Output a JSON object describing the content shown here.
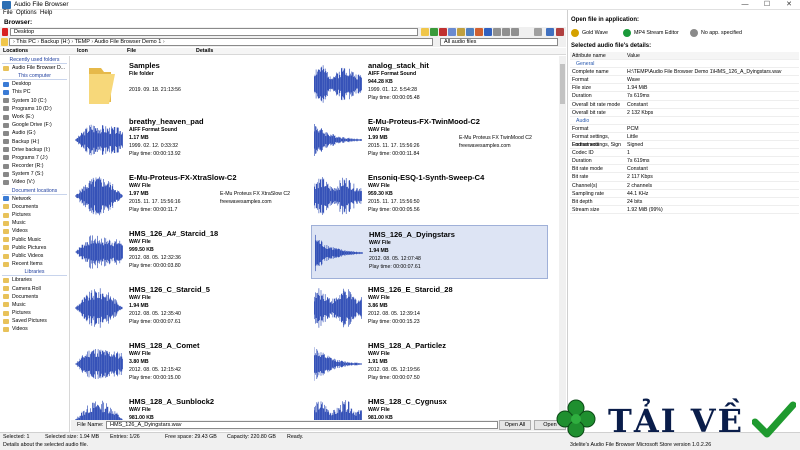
{
  "window": {
    "title": "Audio File Browser",
    "controls": [
      "—",
      "☐",
      "✕"
    ]
  },
  "menu": [
    "File",
    "Options",
    "Help"
  ],
  "browser_label": "Browser:",
  "location_combo": "Desktop",
  "filter_combo": "All audio files",
  "breadcrumb": [
    "This PC",
    "Backup (H:)",
    "TEMP",
    "Audio File Browser Demo 1"
  ],
  "columns": {
    "locations": "Locations",
    "icon": "Icon",
    "file": "File",
    "details": "Details"
  },
  "nav": [
    {
      "type": "group",
      "label": "Recently used folders"
    },
    {
      "type": "item",
      "label": "Audio File Browser D...",
      "color": "#e8c25a"
    },
    {
      "type": "group",
      "label": "This computer"
    },
    {
      "type": "item",
      "label": "Desktop",
      "color": "#3a7bd5"
    },
    {
      "type": "item",
      "label": "This PC",
      "color": "#3a7bd5"
    },
    {
      "type": "item",
      "label": "System 10 (C:)",
      "color": "#888888"
    },
    {
      "type": "item",
      "label": "Programs 10 (D:)",
      "color": "#888888"
    },
    {
      "type": "item",
      "label": "Work (E:)",
      "color": "#888888"
    },
    {
      "type": "item",
      "label": "Google Drive (F:)",
      "color": "#888888"
    },
    {
      "type": "item",
      "label": "Audio (G:)",
      "color": "#888888"
    },
    {
      "type": "item",
      "label": "Backup (H:)",
      "color": "#888888"
    },
    {
      "type": "item",
      "label": "Drive backup (I:)",
      "color": "#888888"
    },
    {
      "type": "item",
      "label": "Programs 7 (J:)",
      "color": "#888888"
    },
    {
      "type": "item",
      "label": "Recorder (R:)",
      "color": "#888888"
    },
    {
      "type": "item",
      "label": "System 7 (S:)",
      "color": "#888888"
    },
    {
      "type": "item",
      "label": "Video (V:)",
      "color": "#888888"
    },
    {
      "type": "group",
      "label": "Document locations"
    },
    {
      "type": "item",
      "label": "Network",
      "color": "#3a7bd5"
    },
    {
      "type": "item",
      "label": "Documents",
      "color": "#e8c25a"
    },
    {
      "type": "item",
      "label": "Pictures",
      "color": "#e8c25a"
    },
    {
      "type": "item",
      "label": "Music",
      "color": "#e8c25a"
    },
    {
      "type": "item",
      "label": "Videos",
      "color": "#e8c25a"
    },
    {
      "type": "item",
      "label": "Public Music",
      "color": "#e8c25a"
    },
    {
      "type": "item",
      "label": "Public Pictures",
      "color": "#e8c25a"
    },
    {
      "type": "item",
      "label": "Public Videos",
      "color": "#e8c25a"
    },
    {
      "type": "item",
      "label": "Recent Items",
      "color": "#e8c25a"
    },
    {
      "type": "group",
      "label": "Libraries"
    },
    {
      "type": "item",
      "label": "Libraries",
      "color": "#e8c25a"
    },
    {
      "type": "item",
      "label": "Camera Roll",
      "color": "#e8c25a"
    },
    {
      "type": "item",
      "label": "Documents",
      "color": "#e8c25a"
    },
    {
      "type": "item",
      "label": "Music",
      "color": "#e8c25a"
    },
    {
      "type": "item",
      "label": "Pictures",
      "color": "#e8c25a"
    },
    {
      "type": "item",
      "label": "Saved Pictures",
      "color": "#e8c25a"
    },
    {
      "type": "item",
      "label": "Videos",
      "color": "#e8c25a"
    }
  ],
  "files": [
    {
      "name": "Samples",
      "type": "File folder",
      "size": "",
      "date": "2019. 09. 18. 21:13:56",
      "play": "",
      "extra1": "",
      "extra2": "",
      "folder": true,
      "selected": false,
      "seed": 0
    },
    {
      "name": "analog_stack_hit",
      "type": "AIFF Format Sound",
      "size": "944.28 KB",
      "date": "1999. 01. 12. 5:54:28",
      "play": "Play time: 00:00:05.48",
      "extra1": "",
      "extra2": "",
      "folder": false,
      "selected": false,
      "seed": 1
    },
    {
      "name": "breathy_heaven_pad",
      "type": "AIFF Format Sound",
      "size": "1.17 MB",
      "date": "1999. 02. 12. 0:33:32",
      "play": "Play time: 00:00:13.92",
      "extra1": "",
      "extra2": "",
      "folder": false,
      "selected": false,
      "seed": 2
    },
    {
      "name": "E-Mu-Proteus-FX-TwinMood-C2",
      "type": "WAV File",
      "size": "1.99 MB",
      "date": "2015. 11. 17. 15:56:26",
      "play": "Play time: 00:00:11.84",
      "extra1": "E-Mu Proteus FX TwinMood C2",
      "extra2": "freewavesamples.com",
      "folder": false,
      "selected": false,
      "seed": 3
    },
    {
      "name": "E-Mu-Proteus-FX-XtraSlow-C2",
      "type": "WAV File",
      "size": "1.97 MB",
      "date": "2015. 11. 17. 15:56:16",
      "play": "Play time: 00:00:11.7",
      "extra1": "E-Mu Proteus FX XtraSlow C2",
      "extra2": "freewavesamples.com",
      "folder": false,
      "selected": false,
      "seed": 4
    },
    {
      "name": "Ensoniq-ESQ-1-Synth-Sweep-C4",
      "type": "WAV File",
      "size": "959.30 KB",
      "date": "2015. 11. 17. 15:56:50",
      "play": "Play time: 00:00:05.56",
      "extra1": "",
      "extra2": "",
      "folder": false,
      "selected": false,
      "seed": 5
    },
    {
      "name": "HMS_126_A#_Starcid_18",
      "type": "WAV File",
      "size": "999.50 KB",
      "date": "2012. 08. 05. 12:32:36",
      "play": "Play time: 00:00:03.80",
      "extra1": "",
      "extra2": "",
      "folder": false,
      "selected": false,
      "seed": 6
    },
    {
      "name": "HMS_126_A_Dyingstars",
      "type": "WAV File",
      "size": "1.94 MB",
      "date": "2012. 08. 05. 12:07:48",
      "play": "Play time: 00:00:07.61",
      "extra1": "",
      "extra2": "",
      "folder": false,
      "selected": true,
      "seed": 7
    },
    {
      "name": "HMS_126_C_Starcid_5",
      "type": "WAV File",
      "size": "1.94 MB",
      "date": "2012. 08. 05. 12:35:40",
      "play": "Play time: 00:00:07.61",
      "extra1": "",
      "extra2": "",
      "folder": false,
      "selected": false,
      "seed": 8
    },
    {
      "name": "HMS_126_E_Starcid_28",
      "type": "WAV File",
      "size": "3.86 MB",
      "date": "2012. 08. 05. 12:39:14",
      "play": "Play time: 00:00:15.23",
      "extra1": "",
      "extra2": "",
      "folder": false,
      "selected": false,
      "seed": 9
    },
    {
      "name": "HMS_128_A_Comet",
      "type": "WAV File",
      "size": "3.80 MB",
      "date": "2012. 08. 05. 12:15:42",
      "play": "Play time: 00:00:15.00",
      "extra1": "",
      "extra2": "",
      "folder": false,
      "selected": false,
      "seed": 10
    },
    {
      "name": "HMS_128_A_Particlez",
      "type": "WAV File",
      "size": "1.91 MB",
      "date": "2012. 08. 05. 12:19:56",
      "play": "Play time: 00:00:07.50",
      "extra1": "",
      "extra2": "",
      "folder": false,
      "selected": false,
      "seed": 11
    },
    {
      "name": "HMS_128_A_Sunblock2",
      "type": "WAV File",
      "size": "981.00 KB",
      "date": "",
      "play": "",
      "extra1": "",
      "extra2": "",
      "folder": false,
      "selected": false,
      "seed": 12
    },
    {
      "name": "HMS_128_C_Cygnusx",
      "type": "WAV File",
      "size": "981.00 KB",
      "date": "",
      "play": "",
      "extra1": "",
      "extra2": "",
      "folder": false,
      "selected": false,
      "seed": 13
    }
  ],
  "filename_bar": {
    "label": "File Name:",
    "value": "HMS_126_A_Dyingstars.wav",
    "open_all": "Open All",
    "open": "Open"
  },
  "status": {
    "selected": "Selected: 1",
    "selected_size": "Selected size: 1.94 MB",
    "entries": "Entries: 1/26",
    "free": "Free space: 29.43 GB",
    "capacity": "Capacity: 220.80 GB",
    "ready": "Ready."
  },
  "status2": {
    "left": "Details about the selected audio file.",
    "right": "3delite's Audio File Browser Microsoft Store version 1.0.2.26"
  },
  "right_panel": {
    "open_title": "Open file in application:",
    "apps": [
      {
        "label": "Gold Wave",
        "color": "#d4a100"
      },
      {
        "label": "MP4 Stream Editor",
        "color": "#1a9a3a"
      },
      {
        "label": "No app. specified",
        "color": "#8a8a8a"
      }
    ],
    "details_title": "Selected audio file's details:",
    "head": [
      "Attribute name",
      "Value"
    ],
    "rows": [
      {
        "k": "General",
        "v": "",
        "sec": true
      },
      {
        "k": "Complete name",
        "v": "H:\\TEMP\\Audio File Browser Demo 1\\HMS_126_A_Dyingstars.wav"
      },
      {
        "k": "Format",
        "v": "Wave"
      },
      {
        "k": "File size",
        "v": "1.94 MiB"
      },
      {
        "k": "Duration",
        "v": "7s 619ms"
      },
      {
        "k": "Overall bit rate mode",
        "v": "Constant"
      },
      {
        "k": "Overall bit rate",
        "v": "2 132 Kbps"
      },
      {
        "k": "Audio",
        "v": "",
        "sec": true
      },
      {
        "k": "Format",
        "v": "PCM"
      },
      {
        "k": "Format settings, Endianness",
        "v": "Little"
      },
      {
        "k": "Format settings, Sign",
        "v": "Signed"
      },
      {
        "k": "Codec ID",
        "v": "1"
      },
      {
        "k": "Duration",
        "v": "7s 619ms"
      },
      {
        "k": "Bit rate mode",
        "v": "Constant"
      },
      {
        "k": "Bit rate",
        "v": "2 117 Kbps"
      },
      {
        "k": "Channel(s)",
        "v": "2 channels"
      },
      {
        "k": "Sampling rate",
        "v": "44.1 KHz"
      },
      {
        "k": "Bit depth",
        "v": "24 bits"
      },
      {
        "k": "Stream size",
        "v": "1.92 MiB (99%)"
      }
    ]
  },
  "watermark": {
    "text": "TẢI VỀ",
    "color": "#0a1d4a"
  },
  "colors": {
    "wave": "#1f3fb0",
    "selection": "#dde4f4",
    "accent": "#2c6fb4"
  }
}
